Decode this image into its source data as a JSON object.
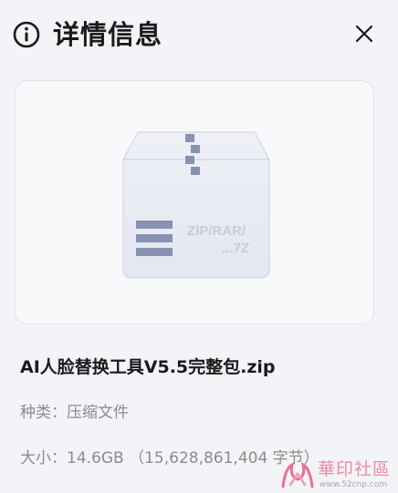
{
  "header": {
    "title": "详情信息",
    "info_icon": "info-circle-icon",
    "close_icon": "close-icon"
  },
  "preview": {
    "archive_icon": "zip-archive-icon",
    "archive_label_line1": "ZIP/RAR/",
    "archive_label_line2": "...7Z"
  },
  "file": {
    "name": "AI人脸替换工具V5.5完整包.zip",
    "type_label": "种类",
    "type_value": "压缩文件",
    "size_label": "大小",
    "size_value": "14.6GB （15,628,861,404 字节）"
  },
  "watermark": {
    "text": "華印社區",
    "url": "www.52cnp.com"
  },
  "colors": {
    "background": "#f2f4f7",
    "card_background": "#f8f9fb",
    "card_border": "#dfe3e9",
    "text_primary": "#1a1a1a",
    "text_secondary": "#8c8c8c",
    "icon_accent": "#8792b3"
  }
}
